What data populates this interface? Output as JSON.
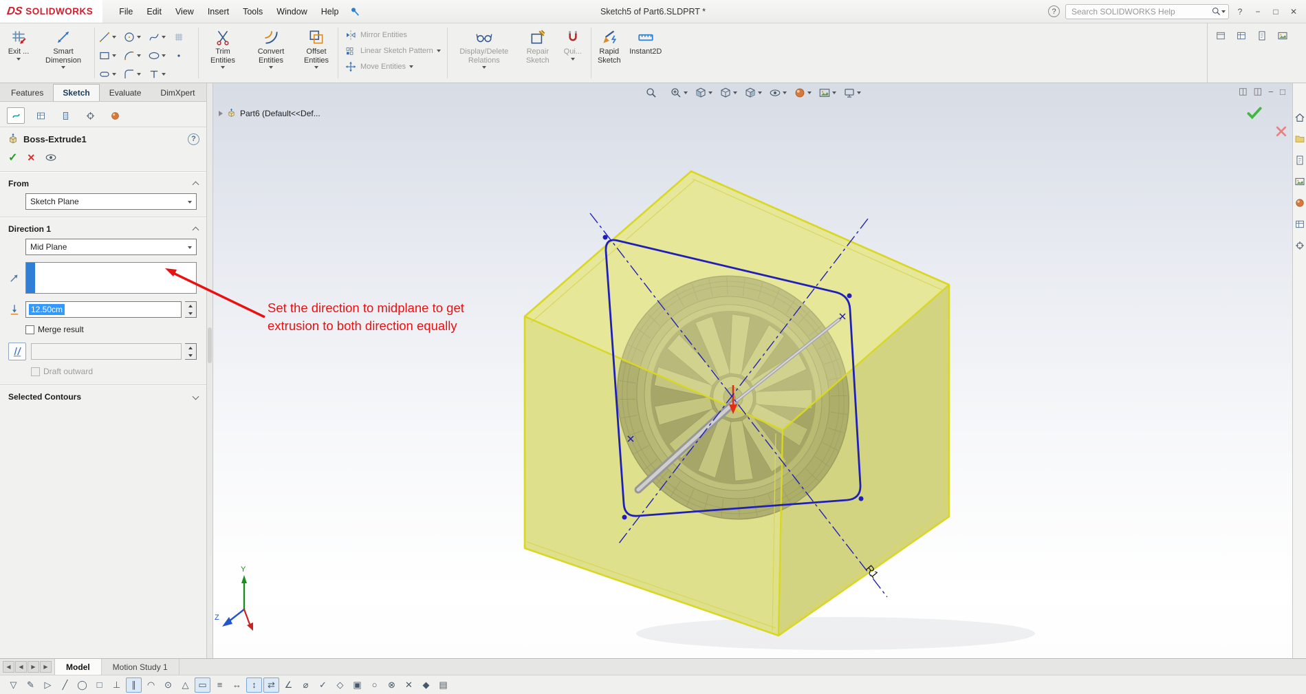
{
  "titlebar": {
    "brand_ds": "DS",
    "brand": "SOLIDWORKS",
    "menus": [
      {
        "name": "menu-file",
        "label": "File"
      },
      {
        "name": "menu-edit",
        "label": "Edit"
      },
      {
        "name": "menu-view",
        "label": "View"
      },
      {
        "name": "menu-insert",
        "label": "Insert"
      },
      {
        "name": "menu-tools",
        "label": "Tools"
      },
      {
        "name": "menu-window",
        "label": "Window"
      },
      {
        "name": "menu-help",
        "label": "Help"
      }
    ],
    "doc_title": "Sketch5 of Part6.SLDPRT *",
    "help_glyph": "?",
    "search_placeholder": "Search SOLIDWORKS Help",
    "window_buttons": [
      {
        "name": "help-button",
        "glyph": "?"
      },
      {
        "name": "minimize-button",
        "glyph": "−"
      },
      {
        "name": "restore-button",
        "glyph": "□"
      },
      {
        "name": "close-button",
        "glyph": "✕"
      }
    ]
  },
  "ribbon": {
    "exit_sketch": "Exit ...",
    "smart_dimension": "Smart Dimension",
    "trim_entities": "Trim Entities",
    "convert_entities": "Convert Entities",
    "offset_entities": "Offset Entities",
    "display_delete_relations": "Display/Delete Relations",
    "repair_sketch": "Repair Sketch",
    "quick_snaps": "Qui...",
    "rapid_sketch": "Rapid Sketch",
    "instant2d": "Instant2D",
    "sketch_tools": [
      {
        "name": "line-tool-icon",
        "sym": "#sym-line",
        "caret": "true"
      },
      {
        "name": "circle-tool-icon",
        "sym": "#sym-circle",
        "caret": "true"
      },
      {
        "name": "spline-tool-icon",
        "sym": "#sym-spline",
        "caret": "true"
      },
      {
        "name": "sketch-grid-icon",
        "sym": "#sym-grid",
        "caret": "false"
      },
      {
        "name": "rectangle-tool-icon",
        "sym": "#sym-rect",
        "caret": "true"
      },
      {
        "name": "arc-tool-icon",
        "sym": "#sym-arc",
        "caret": "true"
      },
      {
        "name": "ellipse-tool-icon",
        "sym": "#sym-ellipse",
        "caret": "true"
      },
      {
        "name": "point-tool-icon",
        "sym": "#sym-point",
        "caret": "false"
      },
      {
        "name": "slot-tool-icon",
        "sym": "#sym-slot",
        "caret": "true"
      },
      {
        "name": "fillet-tool-icon",
        "sym": "#sym-fillet",
        "caret": "true"
      },
      {
        "name": "text-tool-icon",
        "sym": "#sym-text",
        "caret": "true"
      }
    ],
    "stack": [
      {
        "name": "mirror-entities-button",
        "sym": "#sym-mirror",
        "label": "Mirror Entities",
        "caret": "false"
      },
      {
        "name": "linear-sketch-pattern-button",
        "sym": "#sym-pattern",
        "label": "Linear Sketch Pattern",
        "caret": "true"
      },
      {
        "name": "move-entities-button",
        "sym": "#sym-move",
        "label": "Move Entities",
        "caret": "true"
      }
    ],
    "right_icons": [
      {
        "name": "panel-toggle-icon-1",
        "sym": "#sym-window"
      },
      {
        "name": "panel-toggle-icon-2",
        "sym": "#sym-table"
      },
      {
        "name": "panel-toggle-icon-3",
        "sym": "#sym-sheet"
      },
      {
        "name": "panel-toggle-icon-4",
        "sym": "#sym-photo"
      }
    ]
  },
  "command_tabs": [
    {
      "name": "tab-features",
      "label": "Features",
      "active": "false"
    },
    {
      "name": "tab-sketch",
      "label": "Sketch",
      "active": "true"
    },
    {
      "name": "tab-evaluate",
      "label": "Evaluate",
      "active": "false"
    },
    {
      "name": "tab-dimxpert",
      "label": "DimXpert",
      "active": "false"
    }
  ],
  "property_manager": {
    "tabs": [
      {
        "name": "tab-property-manager",
        "sym": "#sym-swirl"
      },
      {
        "name": "tab-feature-manager",
        "sym": "#sym-table"
      },
      {
        "name": "tab-dimxpert-manager",
        "sym": "#sym-tree"
      },
      {
        "name": "tab-display-manager",
        "sym": "#sym-target"
      },
      {
        "name": "tab-configuration-manager",
        "sym": "#sym-ball"
      }
    ],
    "title": "Boss-Extrude1",
    "help_glyph": "?",
    "ok_glyph": "✓",
    "cancel_glyph": "✕",
    "from_header": "From",
    "from_value": "Sketch Plane",
    "direction_header": "Direction 1",
    "direction_value": "Mid Plane",
    "depth_value": "12.50cm",
    "merge_label": "Merge result",
    "draft_label": "Draft outward",
    "contours_header": "Selected Contours"
  },
  "viewport": {
    "tree_item": "Part6 (Default<<Def...",
    "annotation_line1": "Set the direction to midplane to get",
    "annotation_line2": "extrusion to both direction equally",
    "radius_label": "R1",
    "axis_y": "Y",
    "axis_z": "Z",
    "headsup": [
      {
        "name": "zoom-fit-icon",
        "sym": "#sym-magnifier",
        "caret": "false"
      },
      {
        "name": "zoom-area-icon",
        "sym": "#sym-magnifier-plus",
        "caret": "true"
      },
      {
        "name": "section-view-icon",
        "sym": "#sym-section",
        "caret": "true"
      },
      {
        "name": "view-orientation-icon",
        "sym": "#sym-cube",
        "caret": "true"
      },
      {
        "name": "display-style-icon",
        "sym": "#sym-cube-half",
        "caret": "true"
      },
      {
        "name": "hide-show-items-icon",
        "sym": "#sym-eye",
        "caret": "true"
      },
      {
        "name": "edit-appearance-icon",
        "sym": "#sym-ball",
        "caret": "true"
      },
      {
        "name": "apply-scene-icon",
        "sym": "#sym-photo",
        "caret": "true"
      },
      {
        "name": "view-settings-icon",
        "sym": "#sym-monitor",
        "caret": "true"
      }
    ],
    "window_icons": [
      {
        "name": "viewport-split-icon",
        "glyph": "◫"
      },
      {
        "name": "viewport-split2-icon",
        "glyph": "◫"
      },
      {
        "name": "viewport-minimize-icon",
        "glyph": "−"
      },
      {
        "name": "viewport-restore-icon",
        "glyph": "□"
      }
    ]
  },
  "taskpane": {
    "items": [
      {
        "name": "resources-icon",
        "sym": "#sym-home"
      },
      {
        "name": "design-library-icon",
        "sym": "#sym-folder"
      },
      {
        "name": "file-explorer-icon",
        "sym": "#sym-sheet"
      },
      {
        "name": "view-palette-icon",
        "sym": "#sym-photo"
      },
      {
        "name": "appearances-icon",
        "sym": "#sym-ball"
      },
      {
        "name": "custom-properties-icon",
        "sym": "#sym-table"
      },
      {
        "name": "forum-icon",
        "sym": "#sym-target"
      }
    ]
  },
  "footer": {
    "nav": [
      {
        "name": "first-tab-button",
        "glyph": "◀"
      },
      {
        "name": "prev-tab-button",
        "glyph": "◀"
      },
      {
        "name": "next-tab-button",
        "glyph": "▶"
      },
      {
        "name": "last-tab-button",
        "glyph": "▶"
      }
    ],
    "model_tab": "Model",
    "motion_tab": "Motion Study 1",
    "toolbar": [
      {
        "glyph": "▽",
        "active": "false"
      },
      {
        "glyph": "✎",
        "active": "false"
      },
      {
        "glyph": "▷",
        "active": "false"
      },
      {
        "glyph": "╱",
        "active": "false"
      },
      {
        "glyph": "◯",
        "active": "false"
      },
      {
        "glyph": "□",
        "active": "false"
      },
      {
        "glyph": "⊥",
        "active": "false"
      },
      {
        "glyph": "∥",
        "active": "true"
      },
      {
        "glyph": "◠",
        "active": "false"
      },
      {
        "glyph": "⊙",
        "active": "false"
      },
      {
        "glyph": "△",
        "active": "false"
      },
      {
        "glyph": "▭",
        "active": "true"
      },
      {
        "glyph": "≡",
        "active": "false"
      },
      {
        "glyph": "↔",
        "active": "false"
      },
      {
        "glyph": "↕",
        "active": "true"
      },
      {
        "glyph": "⇄",
        "active": "true"
      },
      {
        "glyph": "∠",
        "active": "false"
      },
      {
        "glyph": "⌀",
        "active": "false"
      },
      {
        "glyph": "✓",
        "active": "false"
      },
      {
        "glyph": "◇",
        "active": "false"
      },
      {
        "glyph": "▣",
        "active": "false"
      },
      {
        "glyph": "○",
        "active": "false"
      },
      {
        "glyph": "⊗",
        "active": "false"
      },
      {
        "glyph": "✕",
        "active": "false"
      },
      {
        "glyph": "◆",
        "active": "false"
      },
      {
        "glyph": "▤",
        "active": "false"
      }
    ]
  }
}
